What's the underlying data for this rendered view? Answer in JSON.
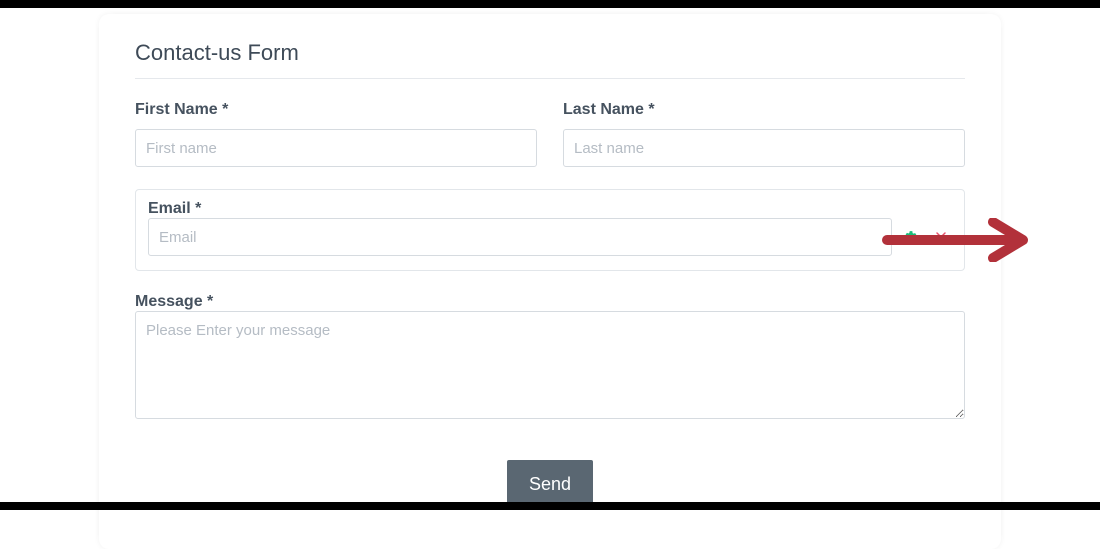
{
  "form": {
    "title": "Contact-us Form",
    "first_name": {
      "label": "First Name *",
      "placeholder": "First name",
      "value": ""
    },
    "last_name": {
      "label": "Last Name *",
      "placeholder": "Last name",
      "value": ""
    },
    "email": {
      "label": "Email *",
      "placeholder": "Email",
      "value": ""
    },
    "message": {
      "label": "Message *",
      "placeholder": "Please Enter your message",
      "value": ""
    },
    "send_label": "Send"
  },
  "icons": {
    "settings": "settings-icon",
    "remove": "close-icon"
  },
  "annotation": {
    "arrow_color": "#b2313a"
  }
}
